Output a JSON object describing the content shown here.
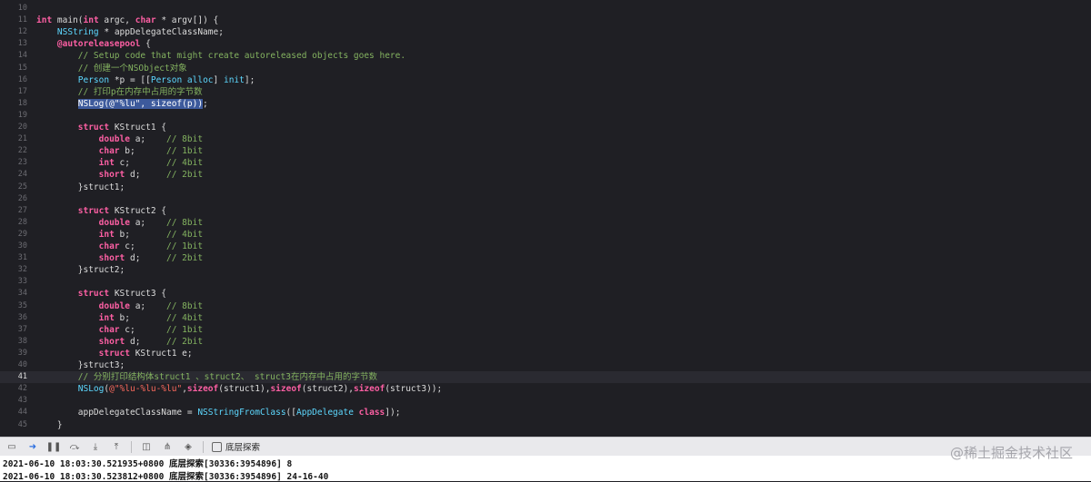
{
  "editor": {
    "current_line": "41",
    "lines": [
      {
        "num": "10",
        "tokens": []
      },
      {
        "num": "11",
        "tokens": [
          [
            "kw",
            "int"
          ],
          [
            "plain",
            " main("
          ],
          [
            "kw",
            "int"
          ],
          [
            "plain",
            " argc, "
          ],
          [
            "kw",
            "char"
          ],
          [
            "plain",
            " * argv[]) {"
          ]
        ]
      },
      {
        "num": "12",
        "tokens": [
          [
            "plain",
            "    "
          ],
          [
            "type",
            "NSString"
          ],
          [
            "plain",
            " * appDelegateClassName;"
          ]
        ]
      },
      {
        "num": "13",
        "tokens": [
          [
            "plain",
            "    "
          ],
          [
            "kw",
            "@autoreleasepool"
          ],
          [
            "plain",
            " {"
          ]
        ]
      },
      {
        "num": "14",
        "tokens": [
          [
            "plain",
            "        "
          ],
          [
            "com",
            "// Setup code that might create autoreleased objects goes here."
          ]
        ]
      },
      {
        "num": "15",
        "tokens": [
          [
            "plain",
            "        "
          ],
          [
            "com",
            "// 创建一个NSObject对象"
          ]
        ]
      },
      {
        "num": "16",
        "tokens": [
          [
            "plain",
            "        "
          ],
          [
            "type",
            "Person"
          ],
          [
            "plain",
            " *p = [["
          ],
          [
            "type",
            "Person"
          ],
          [
            "plain",
            " "
          ],
          [
            "type",
            "alloc"
          ],
          [
            "plain",
            "] "
          ],
          [
            "type",
            "init"
          ],
          [
            "plain",
            "];"
          ]
        ]
      },
      {
        "num": "17",
        "tokens": [
          [
            "plain",
            "        "
          ],
          [
            "com",
            "// 打印p在内存中占用的字节数"
          ]
        ]
      },
      {
        "num": "18",
        "tokens": [
          [
            "plain",
            "        "
          ],
          [
            "sel",
            "NSLog(@\"%lu\", sizeof(p))"
          ],
          [
            "plain",
            ";"
          ]
        ]
      },
      {
        "num": "19",
        "tokens": []
      },
      {
        "num": "20",
        "tokens": [
          [
            "plain",
            "        "
          ],
          [
            "kw",
            "struct"
          ],
          [
            "plain",
            " KStruct1 {"
          ]
        ]
      },
      {
        "num": "21",
        "tokens": [
          [
            "plain",
            "            "
          ],
          [
            "kw",
            "double"
          ],
          [
            "plain",
            " a;    "
          ],
          [
            "com",
            "// 8bit"
          ]
        ]
      },
      {
        "num": "22",
        "tokens": [
          [
            "plain",
            "            "
          ],
          [
            "kw",
            "char"
          ],
          [
            "plain",
            " b;      "
          ],
          [
            "com",
            "// 1bit"
          ]
        ]
      },
      {
        "num": "23",
        "tokens": [
          [
            "plain",
            "            "
          ],
          [
            "kw",
            "int"
          ],
          [
            "plain",
            " c;       "
          ],
          [
            "com",
            "// 4bit"
          ]
        ]
      },
      {
        "num": "24",
        "tokens": [
          [
            "plain",
            "            "
          ],
          [
            "kw",
            "short"
          ],
          [
            "plain",
            " d;     "
          ],
          [
            "com",
            "// 2bit"
          ]
        ]
      },
      {
        "num": "25",
        "tokens": [
          [
            "plain",
            "        }struct1;"
          ]
        ]
      },
      {
        "num": "26",
        "tokens": []
      },
      {
        "num": "27",
        "tokens": [
          [
            "plain",
            "        "
          ],
          [
            "kw",
            "struct"
          ],
          [
            "plain",
            " KStruct2 {"
          ]
        ]
      },
      {
        "num": "28",
        "tokens": [
          [
            "plain",
            "            "
          ],
          [
            "kw",
            "double"
          ],
          [
            "plain",
            " a;    "
          ],
          [
            "com",
            "// 8bit"
          ]
        ]
      },
      {
        "num": "29",
        "tokens": [
          [
            "plain",
            "            "
          ],
          [
            "kw",
            "int"
          ],
          [
            "plain",
            " b;       "
          ],
          [
            "com",
            "// 4bit"
          ]
        ]
      },
      {
        "num": "30",
        "tokens": [
          [
            "plain",
            "            "
          ],
          [
            "kw",
            "char"
          ],
          [
            "plain",
            " c;      "
          ],
          [
            "com",
            "// 1bit"
          ]
        ]
      },
      {
        "num": "31",
        "tokens": [
          [
            "plain",
            "            "
          ],
          [
            "kw",
            "short"
          ],
          [
            "plain",
            " d;     "
          ],
          [
            "com",
            "// 2bit"
          ]
        ]
      },
      {
        "num": "32",
        "tokens": [
          [
            "plain",
            "        }struct2;"
          ]
        ]
      },
      {
        "num": "33",
        "tokens": []
      },
      {
        "num": "34",
        "tokens": [
          [
            "plain",
            "        "
          ],
          [
            "kw",
            "struct"
          ],
          [
            "plain",
            " KStruct3 {"
          ]
        ]
      },
      {
        "num": "35",
        "tokens": [
          [
            "plain",
            "            "
          ],
          [
            "kw",
            "double"
          ],
          [
            "plain",
            " a;    "
          ],
          [
            "com",
            "// 8bit"
          ]
        ]
      },
      {
        "num": "36",
        "tokens": [
          [
            "plain",
            "            "
          ],
          [
            "kw",
            "int"
          ],
          [
            "plain",
            " b;       "
          ],
          [
            "com",
            "// 4bit"
          ]
        ]
      },
      {
        "num": "37",
        "tokens": [
          [
            "plain",
            "            "
          ],
          [
            "kw",
            "char"
          ],
          [
            "plain",
            " c;      "
          ],
          [
            "com",
            "// 1bit"
          ]
        ]
      },
      {
        "num": "38",
        "tokens": [
          [
            "plain",
            "            "
          ],
          [
            "kw",
            "short"
          ],
          [
            "plain",
            " d;     "
          ],
          [
            "com",
            "// 2bit"
          ]
        ]
      },
      {
        "num": "39",
        "tokens": [
          [
            "plain",
            "            "
          ],
          [
            "kw",
            "struct"
          ],
          [
            "plain",
            " KStruct1 e;"
          ]
        ]
      },
      {
        "num": "40",
        "tokens": [
          [
            "plain",
            "        }struct3;"
          ]
        ]
      },
      {
        "num": "41",
        "tokens": [
          [
            "plain",
            "        "
          ],
          [
            "com",
            "// 分别打印结构体struct1 、struct2、 struct3在内存中占用的字节数"
          ]
        ]
      },
      {
        "num": "42",
        "tokens": [
          [
            "plain",
            "        "
          ],
          [
            "type",
            "NSLog"
          ],
          [
            "plain",
            "("
          ],
          [
            "str",
            "@\"%lu-%lu-%lu\""
          ],
          [
            "plain",
            ","
          ],
          [
            "kw",
            "sizeof"
          ],
          [
            "plain",
            "(struct1),"
          ],
          [
            "kw",
            "sizeof"
          ],
          [
            "plain",
            "(struct2),"
          ],
          [
            "kw",
            "sizeof"
          ],
          [
            "plain",
            "(struct3));"
          ]
        ]
      },
      {
        "num": "43",
        "tokens": []
      },
      {
        "num": "44",
        "tokens": [
          [
            "plain",
            "        appDelegateClassName = "
          ],
          [
            "type",
            "NSStringFromClass"
          ],
          [
            "plain",
            "(["
          ],
          [
            "type",
            "AppDelegate"
          ],
          [
            "plain",
            " "
          ],
          [
            "kw",
            "class"
          ],
          [
            "plain",
            "]);"
          ]
        ]
      },
      {
        "num": "45",
        "tokens": [
          [
            "plain",
            "    }"
          ]
        ]
      }
    ]
  },
  "debug_bar": {
    "icons": [
      "hide-debug-area-icon",
      "breakpoints-toggle-icon",
      "pause-icon",
      "step-over-icon",
      "step-into-icon",
      "step-out-icon",
      "view-hierarchy-icon",
      "memory-graph-icon",
      "simulate-location-icon"
    ],
    "target_label": "底层探索"
  },
  "console": {
    "lines": [
      "2021-06-10 18:03:30.521935+0800 底层探索[30336:3954896] 8",
      "2021-06-10 18:03:30.523812+0800 底层探索[30336:3954896] 24-16-40"
    ]
  },
  "watermark": "@稀土掘金技术社区",
  "colors": {
    "background": "#1f1f24",
    "keyword": "#fc5fa3",
    "type": "#5dd8ff",
    "string": "#fc6a5d",
    "comment": "#84b360",
    "selection": "#3d5a9c"
  }
}
